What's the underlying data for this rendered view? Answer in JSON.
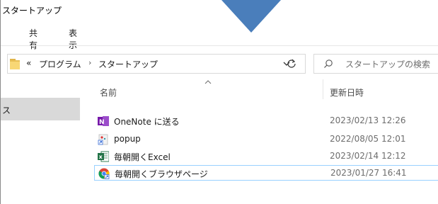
{
  "window": {
    "title": "スタートアップ"
  },
  "ribbon": {
    "tabs": [
      {
        "label": "共有"
      },
      {
        "label": "表示"
      }
    ]
  },
  "address": {
    "overflow": "«",
    "crumbs": [
      {
        "label": "プログラム"
      },
      {
        "label": "スタートアップ"
      }
    ],
    "separator": "›"
  },
  "search": {
    "placeholder": "スタートアップの検索"
  },
  "nav": {
    "selected_label": "ス"
  },
  "columns": {
    "name": "名前",
    "modified": "更新日時"
  },
  "files": [
    {
      "name": "OneNote に送る",
      "modified": "2023/02/13 12:26",
      "icon": "onenote-icon"
    },
    {
      "name": "popup",
      "modified": "2022/08/05 12:01",
      "icon": "shortcut-icon"
    },
    {
      "name": "毎朝開くExcel",
      "modified": "2023/02/14 12:12",
      "icon": "excel-icon"
    },
    {
      "name": "毎朝開くブラウザページ",
      "modified": "2023/01/27 16:41",
      "icon": "chrome-icon",
      "selected": true
    }
  ],
  "colors": {
    "accent_arrow": "#4a7ebb",
    "selection_border": "#99d1ff",
    "nav_selected_bg": "#d9d9d9"
  }
}
